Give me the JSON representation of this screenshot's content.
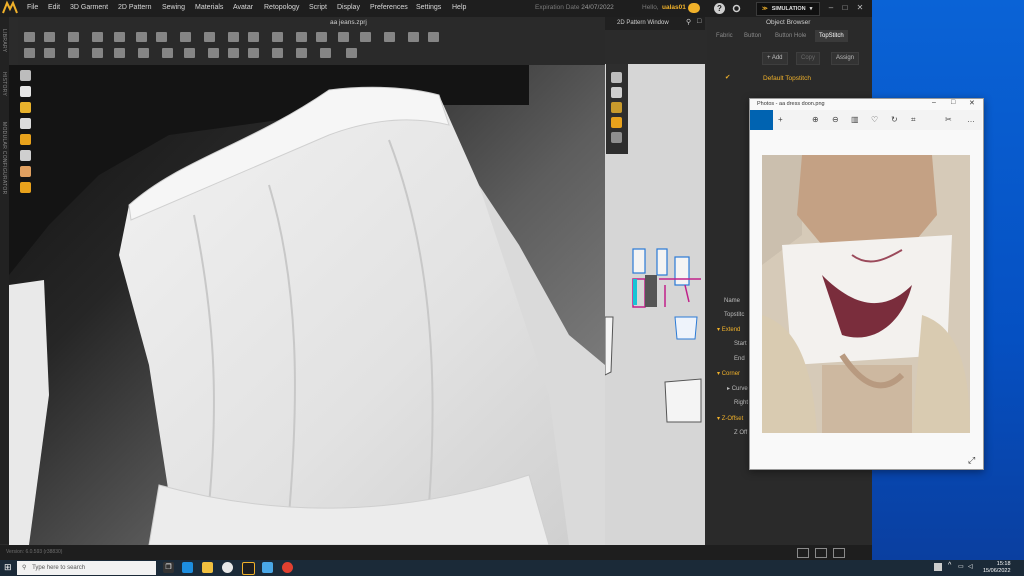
{
  "app": {
    "file_title": "aa jeans.zprj",
    "menu": [
      "File",
      "Edit",
      "3D Garment",
      "2D Pattern",
      "Sewing",
      "Materials",
      "Avatar",
      "Retopology",
      "Script",
      "Display",
      "Preferences",
      "Settings",
      "Help"
    ],
    "expiration_label": "Expiration Date",
    "expiration_date": "24/07/2022",
    "user_label": "Hello,",
    "user_name": "ualas01",
    "simulation_label": "SIMULATION",
    "side_labels": [
      "LIBRARY",
      "HISTORY",
      "MODULAR CONFIGURATOR"
    ],
    "version": "Version: 6.0.593 (r38830)"
  },
  "pattern_window": {
    "title": "2D Pattern Window"
  },
  "object_browser": {
    "title": "Object Browser",
    "tabs": [
      "Fabric",
      "Button",
      "Button Hole",
      "TopStitch"
    ],
    "active_tab": "TopStitch",
    "buttons": {
      "add": "+ Add",
      "copy": "Copy",
      "assign": "Assign"
    },
    "item": "Default Topstitch",
    "properties": {
      "name": "Name",
      "topstitch": "Topstitc",
      "extend": "Extend",
      "start": "Start",
      "end": "End",
      "corner": "Corner",
      "curve": "Curve",
      "right": "Right",
      "z_offset": "Z-Offset",
      "z_offset_val": "Z Off"
    }
  },
  "photos": {
    "title": "Photos - aa dress doon.png"
  },
  "taskbar": {
    "search_placeholder": "Type here to search",
    "time": "15:18",
    "date": "15/06/2022"
  },
  "colors": {
    "accent": "#f0b12a",
    "photos_accent": "#0063b1",
    "desktop": "#0550c2"
  }
}
